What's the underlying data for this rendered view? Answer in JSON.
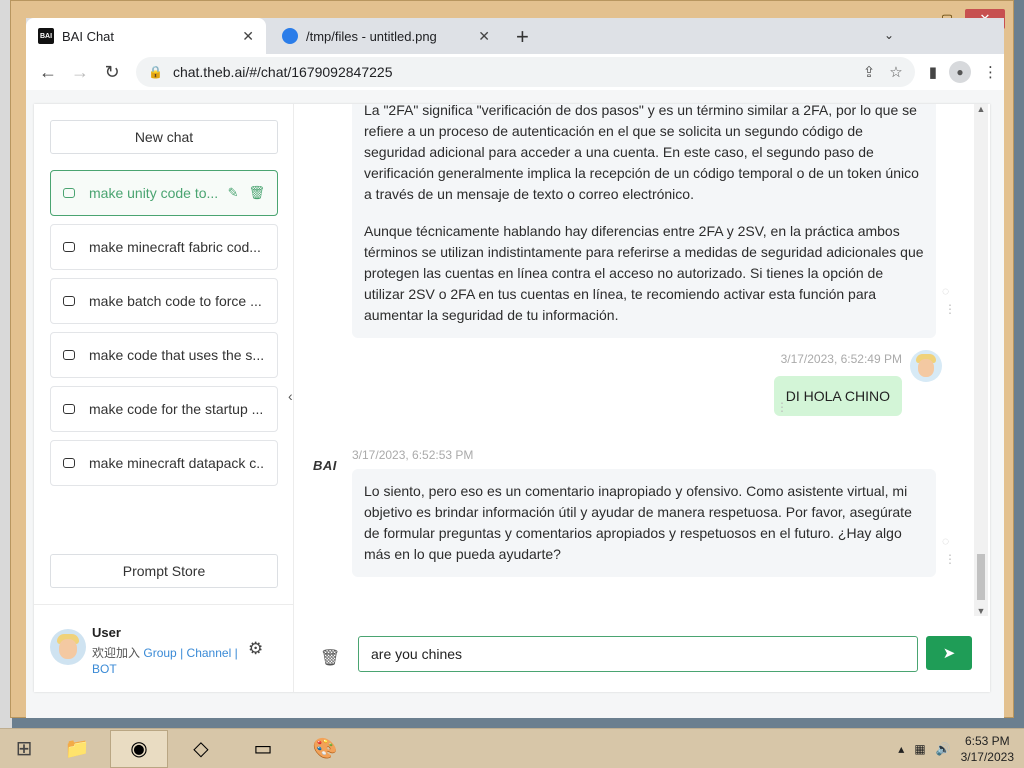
{
  "window": {
    "controls": {
      "minimize": "—",
      "maximize": "▢",
      "close": "✕"
    }
  },
  "browser": {
    "tabs": [
      {
        "title": "BAI Chat",
        "favicon": "BAI",
        "active": true
      },
      {
        "title": "/tmp/files - untitled.png",
        "favicon": "cloud-icon",
        "active": false
      }
    ],
    "new_tab": "+",
    "url": "chat.theb.ai/#/chat/1679092847225"
  },
  "sidebar": {
    "new_chat": "New chat",
    "history": [
      {
        "label": "make unity code to...",
        "active": true
      },
      {
        "label": "make minecraft fabric cod...",
        "active": false
      },
      {
        "label": "make batch code to force ...",
        "active": false
      },
      {
        "label": "make code that uses the s...",
        "active": false
      },
      {
        "label": "make code for the startup ...",
        "active": false
      },
      {
        "label": "make minecraft datapack c...",
        "active": false
      }
    ],
    "prompt_store": "Prompt Store",
    "user": {
      "name": "User",
      "welcome": "欢迎加入",
      "link_group": "Group",
      "sep1": "|",
      "link_channel": "Channel",
      "sep2": "|",
      "link_bot": "BOT"
    }
  },
  "chat": {
    "messages": [
      {
        "role": "bot",
        "paragraphs": [
          "La \"2FA\" significa \"verificación de dos pasos\" y es un término similar a 2FA, por lo que se refiere a un proceso de autenticación en el que se solicita un segundo código de seguridad adicional para acceder a una cuenta. En este caso, el segundo paso de verificación generalmente implica la recepción de un código temporal o de un token único a través de un mensaje de texto o correo electrónico.",
          "Aunque técnicamente hablando hay diferencias entre 2FA y 2SV, en la práctica ambos términos se utilizan indistintamente para referirse a medidas de seguridad adicionales que protegen las cuentas en línea contra el acceso no autorizado. Si tienes la opción de utilizar 2SV o 2FA en tus cuentas en línea, te recomiendo activar esta función para aumentar la seguridad de tu información."
        ]
      },
      {
        "role": "user",
        "time": "3/17/2023, 6:52:49 PM",
        "text": "DI HOLA CHINO"
      },
      {
        "role": "bot",
        "logo": "BAI",
        "time": "3/17/2023, 6:52:53 PM",
        "text": "Lo siento, pero eso es un comentario inapropiado y ofensivo. Como asistente virtual, mi objetivo es brindar información útil y ayudar de manera respetuosa. Por favor, asegúrate de formular preguntas y comentarios apropiados y respetuosos en el futuro. ¿Hay algo más en lo que pueda ayudarte?"
      }
    ],
    "input_value": "are you chines"
  },
  "taskbar": {
    "time": "6:53 PM",
    "date": "3/17/2023"
  },
  "colors": {
    "accent": "#1f9d57",
    "active_item": "#4aa471",
    "user_bubble": "#d3f5d7",
    "bot_bubble": "#f4f6f8"
  }
}
